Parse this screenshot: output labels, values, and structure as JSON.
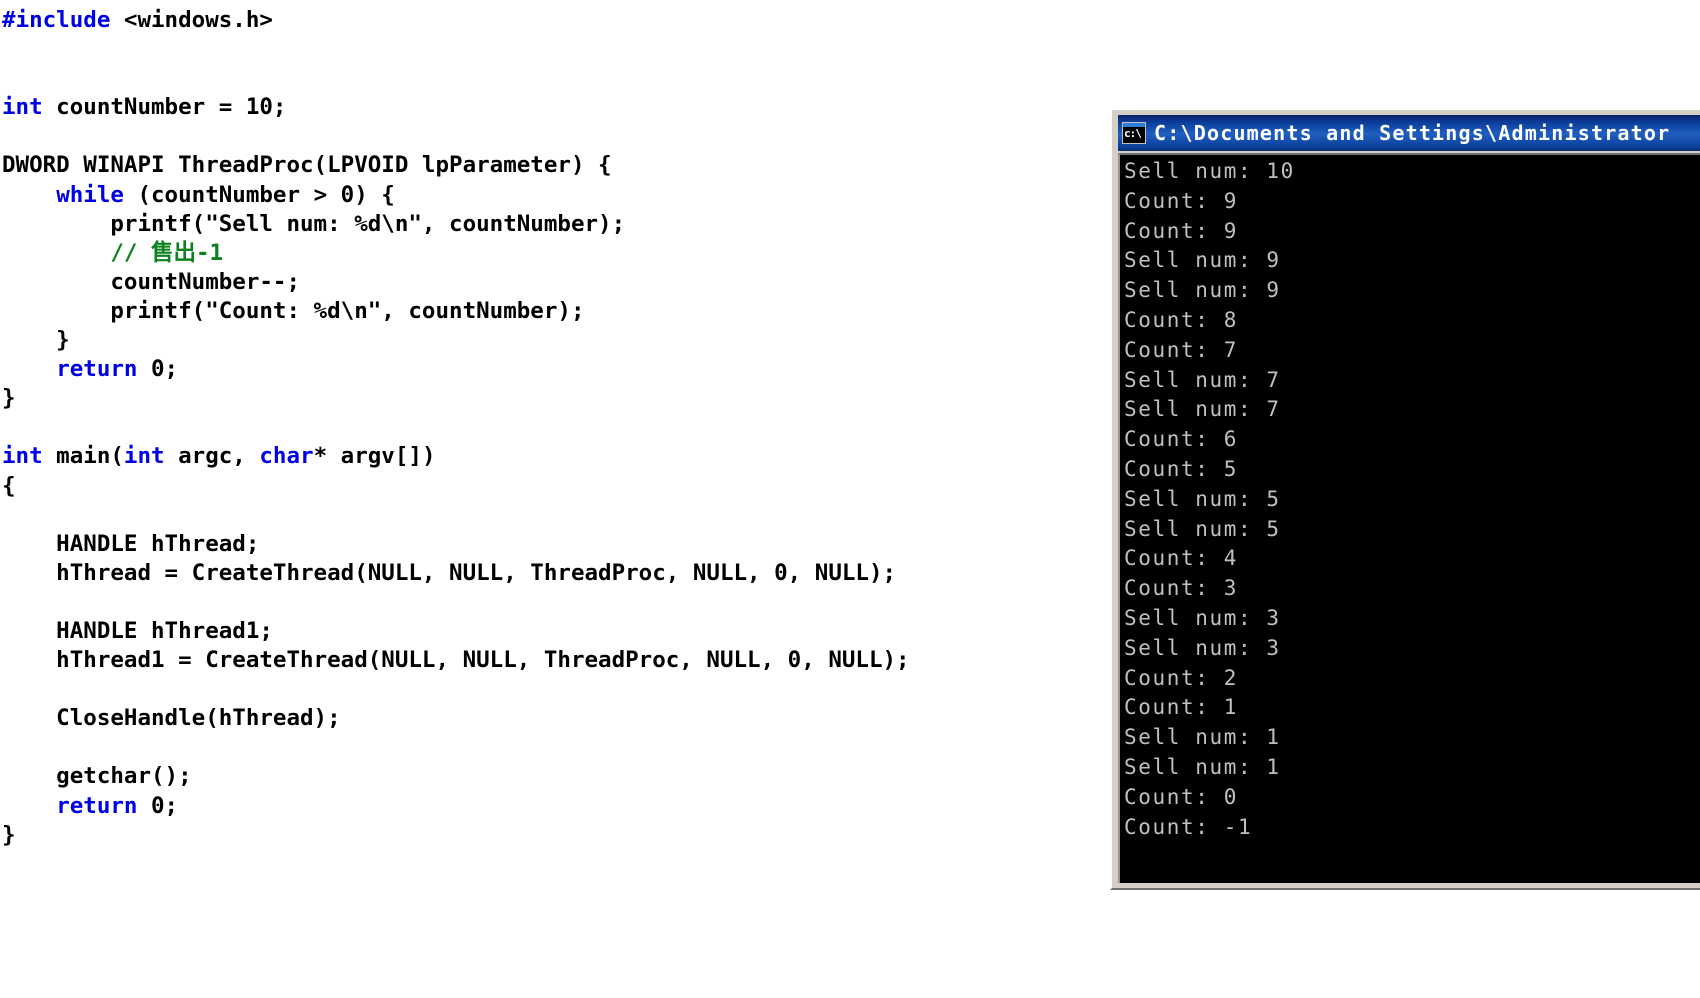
{
  "code": {
    "language": "c",
    "lines": [
      [
        {
          "t": "#include ",
          "c": "pp"
        },
        {
          "t": "<windows.h>",
          "c": "plain"
        }
      ],
      [],
      [],
      [
        {
          "t": "int",
          "c": "kw"
        },
        {
          "t": " countNumber = 10;",
          "c": "plain"
        }
      ],
      [],
      [
        {
          "t": "DWORD WINAPI ThreadProc(LPVOID lpParameter) {",
          "c": "plain"
        }
      ],
      [
        {
          "t": "    ",
          "c": "plain"
        },
        {
          "t": "while",
          "c": "kw"
        },
        {
          "t": " (countNumber > 0) {",
          "c": "plain"
        }
      ],
      [
        {
          "t": "        printf(\"Sell num: %d\\n\", countNumber);",
          "c": "plain"
        }
      ],
      [
        {
          "t": "        ",
          "c": "plain"
        },
        {
          "t": "// 售出-1",
          "c": "cmt"
        }
      ],
      [
        {
          "t": "        countNumber--;",
          "c": "plain"
        }
      ],
      [
        {
          "t": "        printf(\"Count: %d\\n\", countNumber);",
          "c": "plain"
        }
      ],
      [
        {
          "t": "    }",
          "c": "plain"
        }
      ],
      [
        {
          "t": "    ",
          "c": "plain"
        },
        {
          "t": "return",
          "c": "kw"
        },
        {
          "t": " 0;",
          "c": "plain"
        }
      ],
      [
        {
          "t": "}",
          "c": "plain"
        }
      ],
      [],
      [
        {
          "t": "int",
          "c": "kw"
        },
        {
          "t": " main(",
          "c": "plain"
        },
        {
          "t": "int",
          "c": "kw"
        },
        {
          "t": " argc, ",
          "c": "plain"
        },
        {
          "t": "char",
          "c": "kw"
        },
        {
          "t": "* argv[])",
          "c": "plain"
        }
      ],
      [
        {
          "t": "{",
          "c": "plain"
        }
      ],
      [],
      [
        {
          "t": "    HANDLE hThread;",
          "c": "plain"
        }
      ],
      [
        {
          "t": "    hThread = CreateThread(NULL, NULL, ThreadProc, NULL, 0, NULL);",
          "c": "plain"
        }
      ],
      [],
      [
        {
          "t": "    HANDLE hThread1;",
          "c": "plain"
        }
      ],
      [
        {
          "t": "    hThread1 = CreateThread(NULL, NULL, ThreadProc, NULL, 0, NULL);",
          "c": "plain"
        }
      ],
      [],
      [
        {
          "t": "    CloseHandle(hThread);",
          "c": "plain"
        }
      ],
      [],
      [
        {
          "t": "    getchar();",
          "c": "plain"
        }
      ],
      [
        {
          "t": "    ",
          "c": "plain"
        },
        {
          "t": "return",
          "c": "kw"
        },
        {
          "t": " 0;",
          "c": "plain"
        }
      ],
      [
        {
          "t": "}",
          "c": "plain"
        }
      ]
    ],
    "colors": {
      "keyword": "#0000e6",
      "preprocessor": "#0000e6",
      "comment": "#0f8021",
      "text": "#000000",
      "background": "#ffffff"
    }
  },
  "console": {
    "title": "C:\\Documents and Settings\\Administrator",
    "icon_label": "c:\\",
    "icon_name": "console-window-icon",
    "colors": {
      "titlebar": "#0a3a96",
      "client_background": "#000000",
      "text": "#c0c0c0",
      "frame": "#d4d0c8"
    },
    "output_lines": [
      "Sell num: 10",
      "Count: 9",
      "Count: 9",
      "Sell num: 9",
      "Sell num: 9",
      "Count: 8",
      "Count: 7",
      "Sell num: 7",
      "Sell num: 7",
      "Count: 6",
      "Count: 5",
      "Sell num: 5",
      "Sell num: 5",
      "Count: 4",
      "Count: 3",
      "Sell num: 3",
      "Sell num: 3",
      "Count: 2",
      "Count: 1",
      "Sell num: 1",
      "Sell num: 1",
      "Count: 0",
      "Count: -1"
    ]
  }
}
